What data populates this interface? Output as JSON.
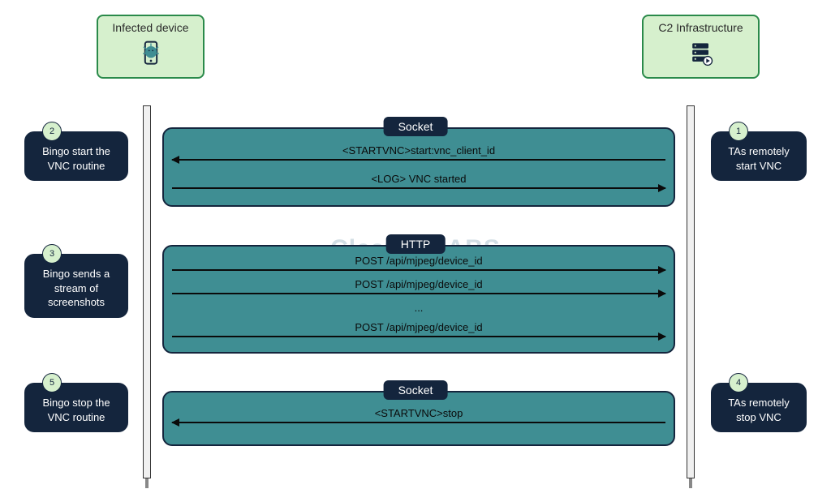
{
  "participants": {
    "left": "Infected device",
    "right": "C2 Infrastructure"
  },
  "watermark": "Cleafy | LABS",
  "boxes": [
    {
      "header": "Socket",
      "messages": [
        {
          "text": "<STARTVNC>start:vnc_client_id",
          "direction": "left"
        },
        {
          "text": "<LOG> VNC started",
          "direction": "right"
        }
      ]
    },
    {
      "header": "HTTP",
      "messages": [
        {
          "text": "POST /api/mjpeg/device_id",
          "direction": "right"
        },
        {
          "text": "POST /api/mjpeg/device_id",
          "direction": "right"
        },
        {
          "text": "...",
          "direction": "none"
        },
        {
          "text": "POST /api/mjpeg/device_id",
          "direction": "right"
        }
      ]
    },
    {
      "header": "Socket",
      "messages": [
        {
          "text": "<STARTVNC>stop",
          "direction": "left"
        }
      ]
    }
  ],
  "notes": {
    "right1": {
      "num": "1",
      "text": "TAs remotely start VNC"
    },
    "left2": {
      "num": "2",
      "text": "Bingo start the VNC routine"
    },
    "left3": {
      "num": "3",
      "text": "Bingo sends a stream of screenshots"
    },
    "right4": {
      "num": "4",
      "text": "TAs remotely stop VNC"
    },
    "left5": {
      "num": "5",
      "text": "Bingo stop the VNC routine"
    }
  }
}
